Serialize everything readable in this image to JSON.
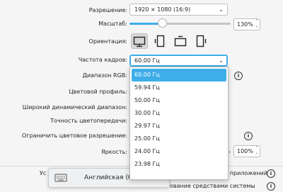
{
  "resolution": {
    "label": "Разрешение:",
    "value": "1920 × 1080 (16:9)"
  },
  "scale": {
    "label": "Масштаб:",
    "value": "130%",
    "level_fraction": 0.31
  },
  "orientation": {
    "label": "Ориентация:"
  },
  "refresh_rate": {
    "label": "Частота кадров:",
    "value": "60.00 Гц",
    "options": [
      "60.00 Гц",
      "59.94 Гц",
      "50.00 Гц",
      "30.00 Гц",
      "29.97 Гц",
      "25.00 Гц",
      "24.00 Гц",
      "23.98 Гц"
    ]
  },
  "rgb_range": {
    "label": "Диапазон RGB:"
  },
  "color_profile": {
    "label": "Цветовой профиль:"
  },
  "hdr": {
    "label": "Широкий динамический диапазон:"
  },
  "color_accuracy": {
    "label": "Точность цветопередачи:"
  },
  "limit_color_resolution": {
    "label": "Ограничить цветовое разрешение:"
  },
  "brightness": {
    "label": "Яркость:",
    "value": "100%"
  },
  "footer": {
    "row1_left": "Ус",
    "row1_right": "ование средствами приложений",
    "row2_right": "ование средствами системы"
  },
  "keyboard_osd": {
    "text": "Английская (США)"
  },
  "colors": {
    "accent": "#3daee9",
    "background": "#f5f5f5"
  }
}
